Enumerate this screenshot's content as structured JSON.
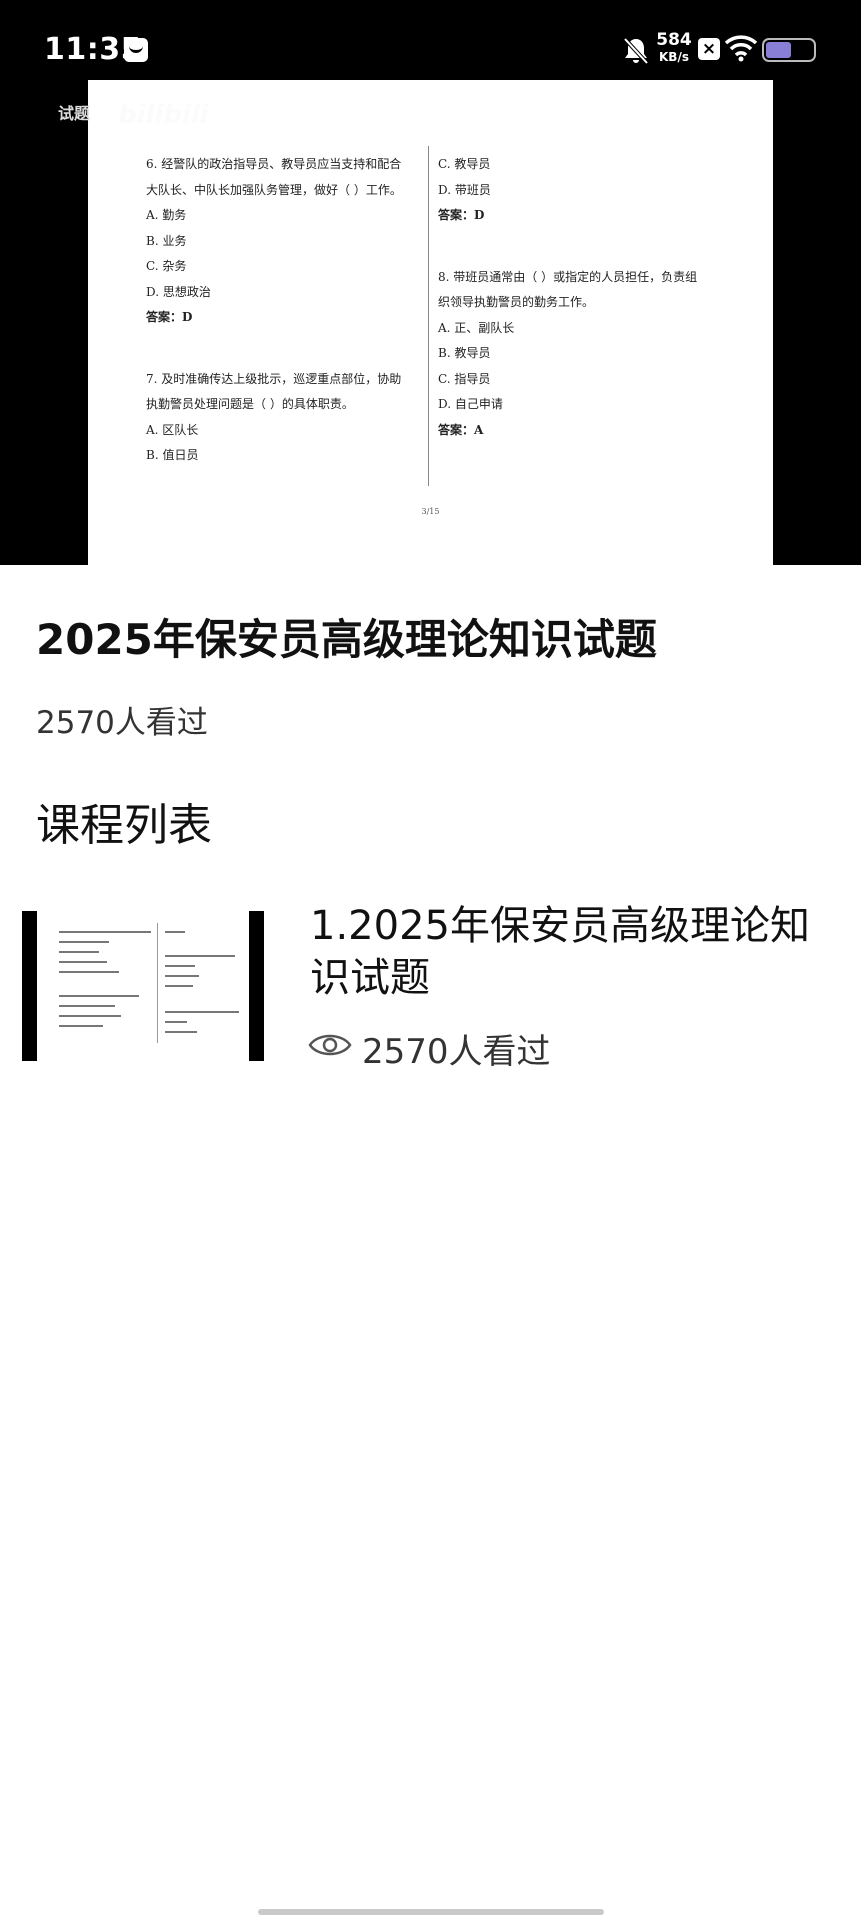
{
  "status_bar": {
    "time": "11:35",
    "net_speed": "584",
    "net_unit": "KB/s"
  },
  "player": {
    "title": "试题",
    "watermark": "bilibili",
    "doc": {
      "left_col": [
        {
          "text": "6. 经警队的政治指导员、教导员应当支持和配合",
          "style": "line"
        },
        {
          "text": "大队长、中队长加强队务管理，做好（ ）工作。",
          "style": "line"
        },
        {
          "text": "A.  勤务",
          "style": "line"
        },
        {
          "text": "B.  业务",
          "style": "line"
        },
        {
          "text": "C.  杂务",
          "style": "line"
        },
        {
          "text": "D.  思想政治",
          "style": "line"
        },
        {
          "text": "答案：D",
          "style": "answer"
        },
        {
          "text": "",
          "style": "gap"
        },
        {
          "text": "7. 及时准确传达上级批示，巡逻重点部位，协助",
          "style": "line"
        },
        {
          "text": "执勤警员处理问题是（ ）的具体职责。",
          "style": "line"
        },
        {
          "text": "A.  区队长",
          "style": "line"
        },
        {
          "text": "B.  值日员",
          "style": "line"
        }
      ],
      "right_col": [
        {
          "text": "C.  教导员",
          "style": "line"
        },
        {
          "text": "D.  带班员",
          "style": "line"
        },
        {
          "text": "答案：D",
          "style": "answer"
        },
        {
          "text": "",
          "style": "gap"
        },
        {
          "text": "8. 带班员通常由（ ）或指定的人员担任，负责组",
          "style": "line"
        },
        {
          "text": "织领导执勤警员的勤务工作。",
          "style": "line"
        },
        {
          "text": "A.  正、副队长",
          "style": "line"
        },
        {
          "text": "B.  教导员",
          "style": "line"
        },
        {
          "text": "C.  指导员",
          "style": "line"
        },
        {
          "text": "D.  自己申请",
          "style": "line"
        },
        {
          "text": "答案：A",
          "style": "answer"
        }
      ],
      "page_num": "3/15"
    }
  },
  "main": {
    "title": "2025年保安员高级理论知识试题",
    "views": "2570人看过",
    "section_title": "课程列表"
  },
  "course_list": [
    {
      "title": "1.2025年保安员高级理论知识试题",
      "views": "2570人看过",
      "icon": "eye-icon"
    }
  ],
  "colors": {
    "player_bg": "#000000",
    "battery": "#8a7fd6",
    "home_indicator": "#c9c9c9"
  }
}
